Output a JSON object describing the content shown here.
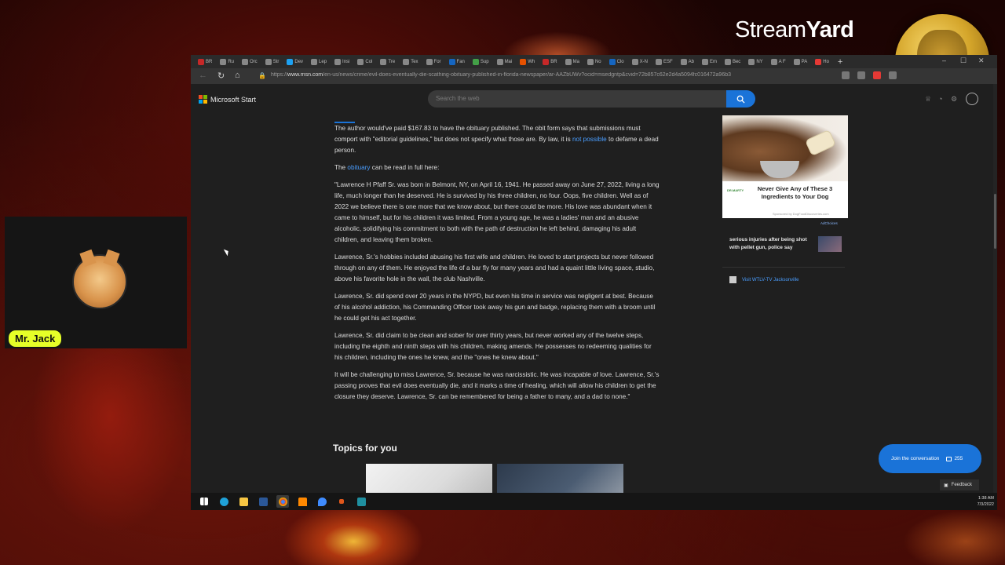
{
  "streamyard": {
    "logo_light": "Stream",
    "logo_bold": "Yard"
  },
  "guest": {
    "name": "Mr. Jack"
  },
  "browser": {
    "tabs": [
      {
        "label": "BR",
        "color": "#c62828"
      },
      {
        "label": "Ru",
        "color": "#888"
      },
      {
        "label": "Orc",
        "color": "#888"
      },
      {
        "label": "Str",
        "color": "#888"
      },
      {
        "label": "Dev",
        "color": "#1da1f2"
      },
      {
        "label": "Lep",
        "color": "#888"
      },
      {
        "label": "Insi",
        "color": "#888"
      },
      {
        "label": "Col",
        "color": "#888"
      },
      {
        "label": "Tre",
        "color": "#888"
      },
      {
        "label": "Tex",
        "color": "#888"
      },
      {
        "label": "For",
        "color": "#888"
      },
      {
        "label": "Fan",
        "color": "#1565c0"
      },
      {
        "label": "Sup",
        "color": "#43a047"
      },
      {
        "label": "Mai",
        "color": "#888"
      },
      {
        "label": "Wh",
        "color": "#e65100"
      },
      {
        "label": "BR",
        "color": "#c62828"
      },
      {
        "label": "Ma",
        "color": "#888"
      },
      {
        "label": "No",
        "color": "#888"
      },
      {
        "label": "Clo",
        "color": "#1565c0"
      },
      {
        "label": "X-N",
        "color": "#888"
      },
      {
        "label": "ESF",
        "color": "#888"
      },
      {
        "label": "Ab",
        "color": "#888"
      },
      {
        "label": "Em",
        "color": "#888"
      },
      {
        "label": "Bec",
        "color": "#888"
      },
      {
        "label": "NY",
        "color": "#888"
      },
      {
        "label": "A F",
        "color": "#888"
      },
      {
        "label": "PA",
        "color": "#888"
      },
      {
        "label": "Ho",
        "color": "#e53935"
      }
    ],
    "url_scheme": "https://",
    "url_host": "www.msn.com",
    "url_path": "/en-us/news/crime/evil-does-eventually-die-scathing-obituary-published-in-florida-newspaper/ar-AAZbUWv?ocid=msedgntp&cvid=72b857c62e2d4a5094fc016472a96b3"
  },
  "site": {
    "brand": "Microsoft Start",
    "search_placeholder": "Search the web"
  },
  "article": {
    "p1_a": "The author would've paid $167.83 to have the obituary published. The obit form says that submissions must comport with \"editorial guidelines,\" but does not specify what those are. By law, it is ",
    "p1_link": "not possible",
    "p1_b": " to defame a dead person.",
    "p2_a": "The ",
    "p2_link": "obituary",
    "p2_b": " can be read in full here:",
    "p3": "\"Lawrence H Pfaff Sr. was born in Belmont, NY, on April 16, 1941. He passed away on June 27, 2022, living a long life, much longer than he deserved. He is survived by his three children, no four. Oops, five children. Well as of 2022 we believe there is one more that we know about, but there could be more. His love was abundant when it came to himself, but for his children it was limited. From a young age, he was a ladies' man and an abusive alcoholic, solidifying his commitment to both with the path of destruction he left behind, damaging his adult children, and leaving them broken.",
    "p4": "Lawrence, Sr.'s hobbies included abusing his first wife and children. He loved to start projects but never followed through on any of them. He enjoyed the life of a bar fly for many years and had a quaint little living space, studio, above his favorite hole in the wall, the club Nashville.",
    "p5": "Lawrence, Sr. did spend over 20 years in the NYPD, but even his time in service was negligent at best. Because of his alcohol addiction, his Commanding Officer took away his gun and badge, replacing them with a broom until he could get his act together.",
    "p6": "Lawrence, Sr. did claim to be clean and sober for over thirty years, but never worked any of the twelve steps, including the eighth and ninth steps with his children, making amends. He possesses no redeeming qualities for his children, including the ones he knew, and the \"ones he knew about.\"",
    "p7": "It will be challenging to miss Lawrence, Sr. because he was narcissistic. He was incapable of love. Lawrence, Sr.'s passing proves that evil does eventually die, and it marks a time of healing, which will allow his children to get the closure they deserve. Lawrence, Sr. can be remembered for being a father to many, and a dad to none.\""
  },
  "topics": {
    "heading": "Topics for you"
  },
  "sidebar": {
    "ad_brand": "DR.MARTY",
    "ad_title": "Never Give Any of These 3 Ingredients to Your Dog",
    "ad_sponsor": "Sponsored by DogFoodDiscoveries.com",
    "adchoices": "AdChoices",
    "news_title": "serious injuries after being shot with pellet gun, police say",
    "source": "Visit WTLV-TV Jacksonville"
  },
  "conversation": {
    "label": "Join the conversation",
    "count": "255"
  },
  "feedback": {
    "label": "Feedback"
  },
  "taskbar": {
    "time": "1:38 AM",
    "date": "7/3/2022"
  },
  "colors": {
    "accent": "#1a73d8",
    "link": "#4a9eff",
    "guest_badge": "#e6ff28"
  }
}
